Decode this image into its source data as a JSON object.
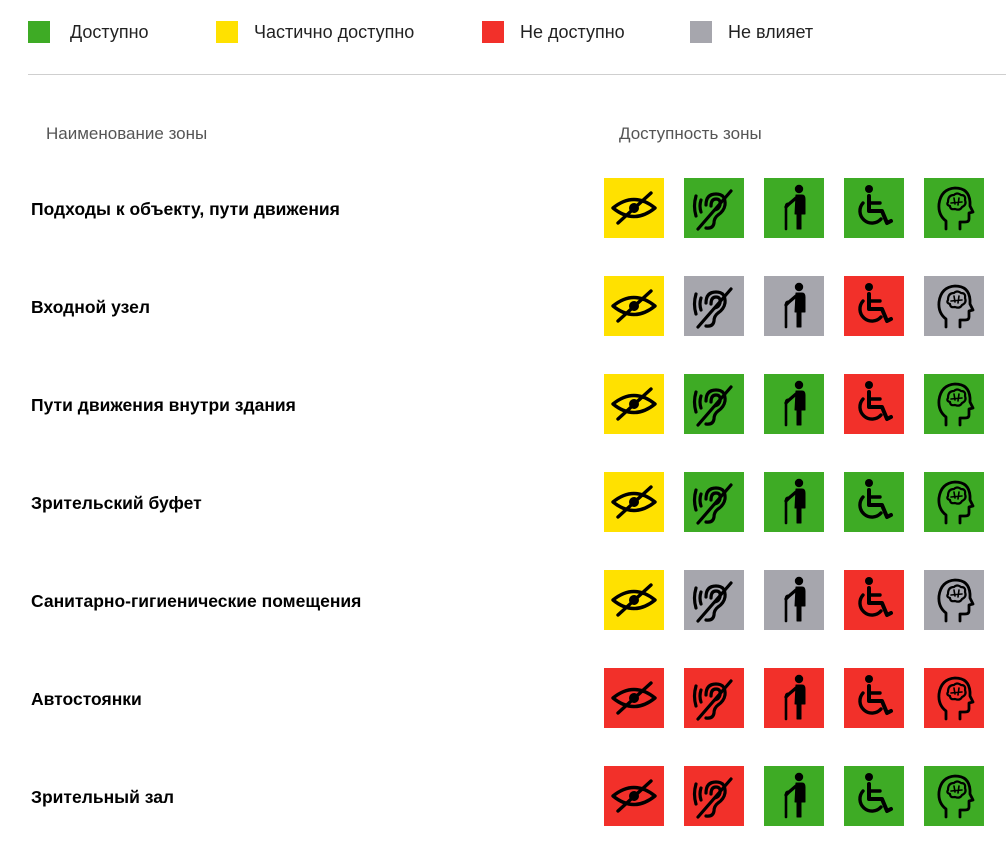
{
  "colors": {
    "available": "#3eab25",
    "partial": "#ffe100",
    "unavailable": "#f2302a",
    "not_affected": "#a6a6ad"
  },
  "legend": [
    {
      "status": "available",
      "label": "Доступно"
    },
    {
      "status": "partial",
      "label": "Частично доступно"
    },
    {
      "status": "unavailable",
      "label": "Не доступно"
    },
    {
      "status": "not_affected",
      "label": "Не влияет"
    }
  ],
  "table": {
    "col_zone": "Наименование зоны",
    "col_access": "Доступность зоны",
    "categories": [
      "vision-impaired-icon",
      "hearing-impaired-icon",
      "elderly-cane-icon",
      "wheelchair-icon",
      "mental-head-icon"
    ],
    "rows": [
      {
        "name": "Подходы к объекту, пути движения",
        "status": [
          "partial",
          "available",
          "available",
          "available",
          "available"
        ]
      },
      {
        "name": "Входной узел",
        "status": [
          "partial",
          "not_affected",
          "not_affected",
          "unavailable",
          "not_affected"
        ]
      },
      {
        "name": "Пути движения внутри здания",
        "status": [
          "partial",
          "available",
          "available",
          "unavailable",
          "available"
        ]
      },
      {
        "name": "Зрительский буфет",
        "status": [
          "partial",
          "available",
          "available",
          "available",
          "available"
        ]
      },
      {
        "name": "Санитарно-гигиенические помещения",
        "status": [
          "partial",
          "not_affected",
          "not_affected",
          "unavailable",
          "not_affected"
        ]
      },
      {
        "name": "Автостоянки",
        "status": [
          "unavailable",
          "unavailable",
          "unavailable",
          "unavailable",
          "unavailable"
        ]
      },
      {
        "name": "Зрительный зал",
        "status": [
          "unavailable",
          "unavailable",
          "available",
          "available",
          "available"
        ]
      }
    ]
  }
}
